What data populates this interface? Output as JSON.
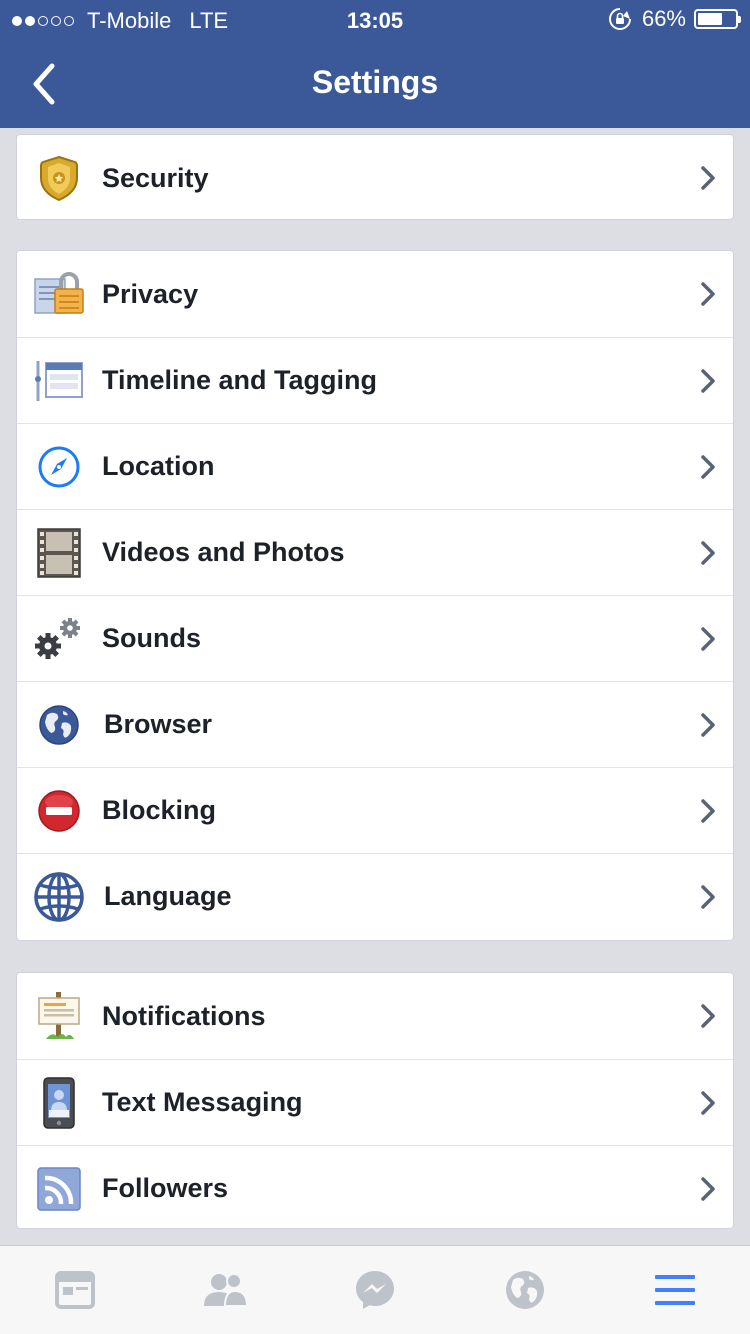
{
  "status_bar": {
    "signal_bars_filled": 2,
    "signal_bars_total": 5,
    "carrier": "T-Mobile",
    "network": "LTE",
    "time": "13:05",
    "battery_percent": "66%",
    "battery_level": 0.66
  },
  "nav": {
    "title": "Settings",
    "back_icon": "chevron-left-icon"
  },
  "groups": [
    {
      "items": [
        {
          "label": "Security",
          "icon": "shield-badge-icon"
        }
      ]
    },
    {
      "items": [
        {
          "label": "Privacy",
          "icon": "lock-icon"
        },
        {
          "label": "Timeline and Tagging",
          "icon": "timeline-icon"
        },
        {
          "label": "Location",
          "icon": "compass-icon"
        },
        {
          "label": "Videos and Photos",
          "icon": "film-strip-icon"
        },
        {
          "label": "Sounds",
          "icon": "gears-icon"
        },
        {
          "label": "Browser",
          "icon": "globe-icon"
        },
        {
          "label": "Blocking",
          "icon": "blocked-icon"
        },
        {
          "label": "Language",
          "icon": "language-globe-icon"
        }
      ]
    },
    {
      "items": [
        {
          "label": "Notifications",
          "icon": "signpost-icon"
        },
        {
          "label": "Text Messaging",
          "icon": "phone-icon"
        },
        {
          "label": "Followers",
          "icon": "rss-icon"
        }
      ]
    }
  ],
  "tabbar": {
    "tabs": [
      {
        "icon": "news-feed-icon",
        "active": false
      },
      {
        "icon": "friends-icon",
        "active": false
      },
      {
        "icon": "messenger-icon",
        "active": false
      },
      {
        "icon": "notifications-globe-icon",
        "active": false
      },
      {
        "icon": "menu-icon",
        "active": true
      }
    ]
  },
  "colors": {
    "brand": "#3b5998",
    "active_tab": "#4080ff",
    "inactive_tab": "#bec2c9",
    "chevron": "#5a6375"
  }
}
